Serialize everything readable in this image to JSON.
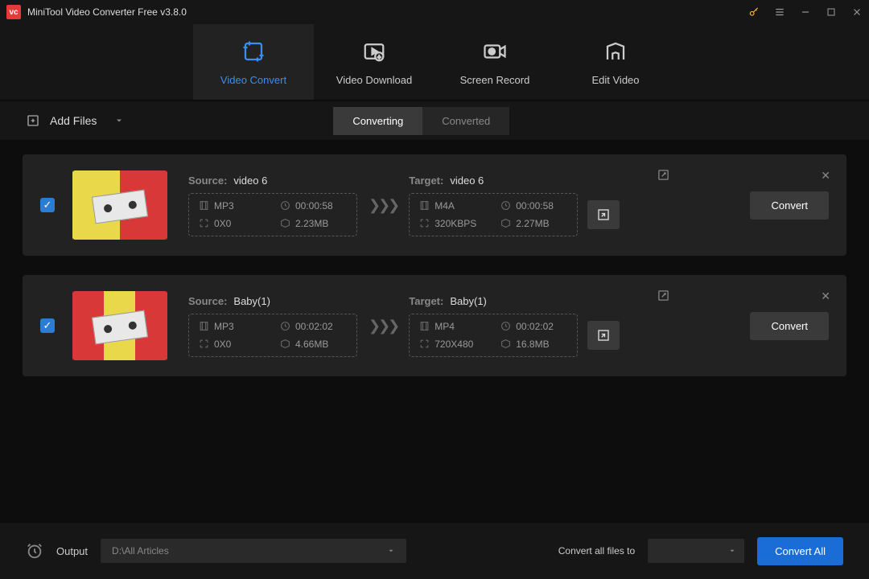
{
  "app": {
    "title": "MiniTool Video Converter Free v3.8.0"
  },
  "main_tabs": [
    {
      "label": "Video Convert",
      "active": true
    },
    {
      "label": "Video Download",
      "active": false
    },
    {
      "label": "Screen Record",
      "active": false
    },
    {
      "label": "Edit Video",
      "active": false
    }
  ],
  "toolbar": {
    "add_files": "Add Files"
  },
  "sub_tabs": {
    "converting": "Converting",
    "converted": "Converted"
  },
  "files": [
    {
      "checked": true,
      "source_label": "Source:",
      "source_name": "video 6",
      "source": {
        "format": "MP3",
        "duration": "00:00:58",
        "resolution": "0X0",
        "size": "2.23MB"
      },
      "target_label": "Target:",
      "target_name": "video 6",
      "target": {
        "format": "M4A",
        "duration": "00:00:58",
        "resolution": "320KBPS",
        "size": "2.27MB"
      },
      "convert_label": "Convert"
    },
    {
      "checked": true,
      "source_label": "Source:",
      "source_name": "Baby(1)",
      "source": {
        "format": "MP3",
        "duration": "00:02:02",
        "resolution": "0X0",
        "size": "4.66MB"
      },
      "target_label": "Target:",
      "target_name": "Baby(1)",
      "target": {
        "format": "MP4",
        "duration": "00:02:02",
        "resolution": "720X480",
        "size": "16.8MB"
      },
      "convert_label": "Convert"
    }
  ],
  "footer": {
    "output_label": "Output",
    "output_path": "D:\\All Articles",
    "convert_all_label": "Convert all files to",
    "convert_all_btn": "Convert All"
  }
}
